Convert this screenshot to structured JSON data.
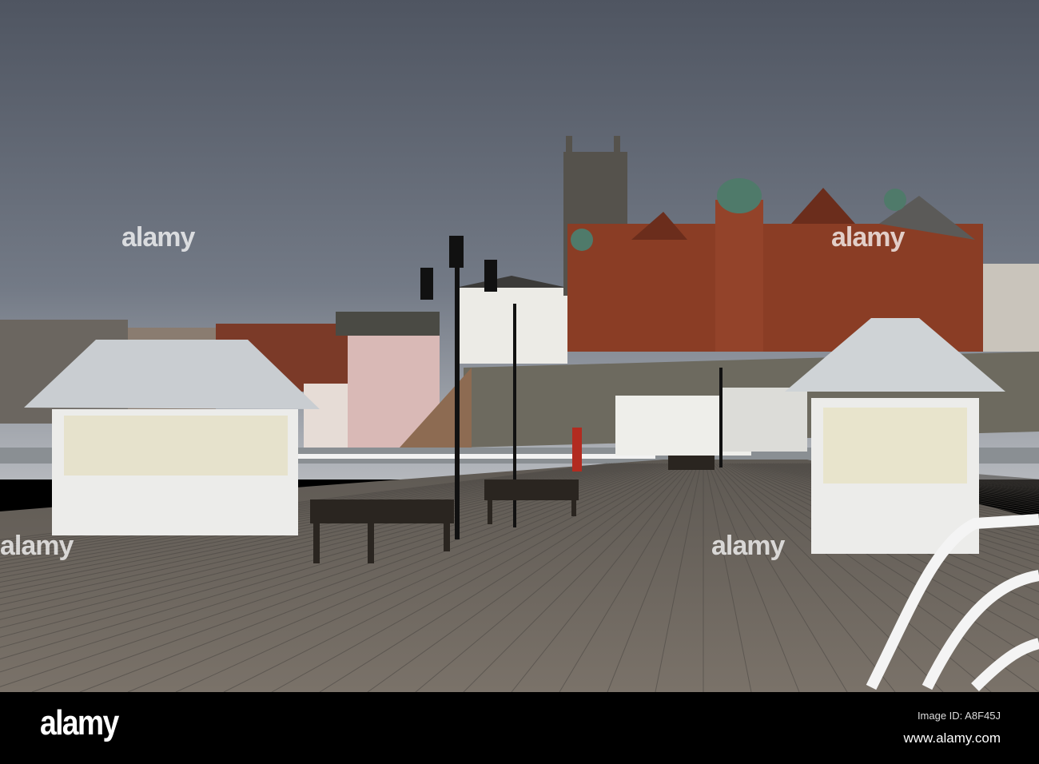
{
  "watermark": "alamy",
  "footer": {
    "logo": "alamy",
    "image_id": "Image ID: A8F45J",
    "url": "www.alamy.com"
  },
  "colors": {
    "sky": "#5d6470",
    "deck": "#6e6860",
    "brick": "#8a3d25",
    "shelter": "#e8e8e4"
  }
}
